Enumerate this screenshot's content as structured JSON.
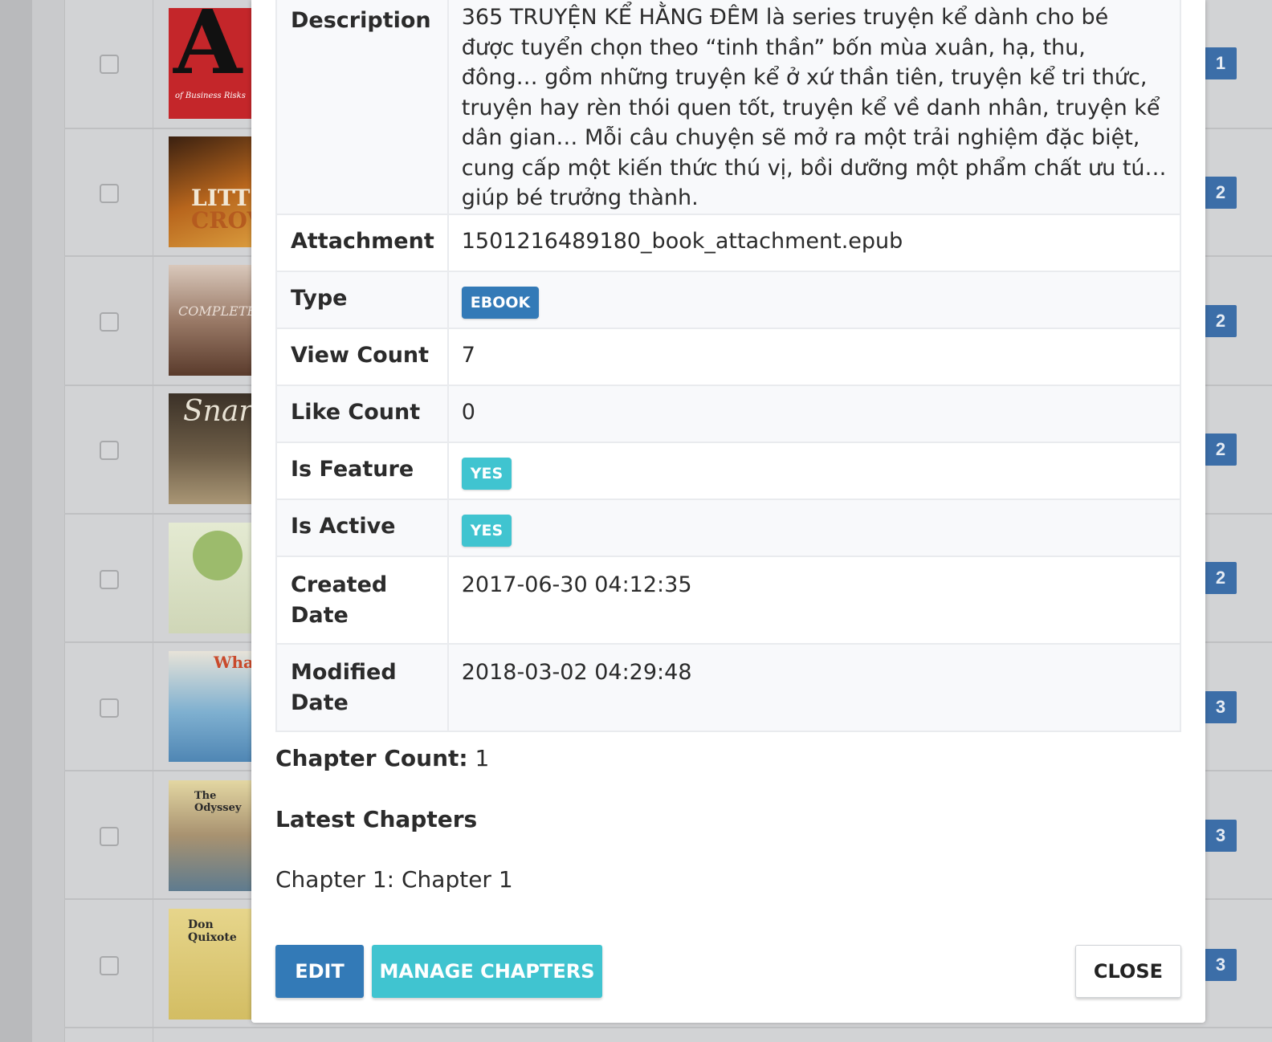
{
  "background": {
    "badges": [
      "1",
      "2",
      "2",
      "2",
      "2",
      "3",
      "3",
      "3"
    ],
    "cover_texts": [
      "A",
      "of Business Risks",
      "LITT",
      "CROV",
      "COMPLETE",
      "Snark",
      "What",
      "The Odyssey",
      "Don Quixote"
    ]
  },
  "detail": {
    "description_label": "Description",
    "description_value": "365 TRUYỆN KỂ HẰNG ĐÊM là series truyện kể dành cho bé được tuyển chọn theo “tinh thần” bốn mùa xuân, hạ, thu, đông… gồm những truyện kể ở xứ thần tiên, truyện kể tri thức, truyện hay rèn thói quen tốt, truyện kể về danh nhân, truyện kể dân gian… Mỗi câu chuyện sẽ mở ra một trải nghiệm đặc biệt, cung cấp một kiến thức thú vị, bồi dưỡng một phẩm chất ưu tú… giúp bé trưởng thành.",
    "attachment_label": "Attachment",
    "attachment_value": "1501216489180_book_attachment.epub",
    "type_label": "Type",
    "type_value": "EBOOK",
    "view_count_label": "View Count",
    "view_count_value": "7",
    "like_count_label": "Like Count",
    "like_count_value": "0",
    "is_feature_label": "Is Feature",
    "is_feature_value": "YES",
    "is_active_label": "Is Active",
    "is_active_value": "YES",
    "created_date_label": "Created Date",
    "created_date_value": "2017-06-30 04:12:35",
    "modified_date_label": "Modified Date",
    "modified_date_value": "2018-03-02 04:29:48"
  },
  "chapters": {
    "count_label": "Chapter Count:",
    "count_value": "1",
    "latest_heading": "Latest Chapters",
    "items": [
      "Chapter 1: Chapter 1"
    ]
  },
  "buttons": {
    "edit": "EDIT",
    "manage_chapters": "MANAGE CHAPTERS",
    "close": "CLOSE"
  },
  "colors": {
    "primary": "#337ab7",
    "info": "#40c4d0",
    "badge": "#3c6ea8"
  }
}
